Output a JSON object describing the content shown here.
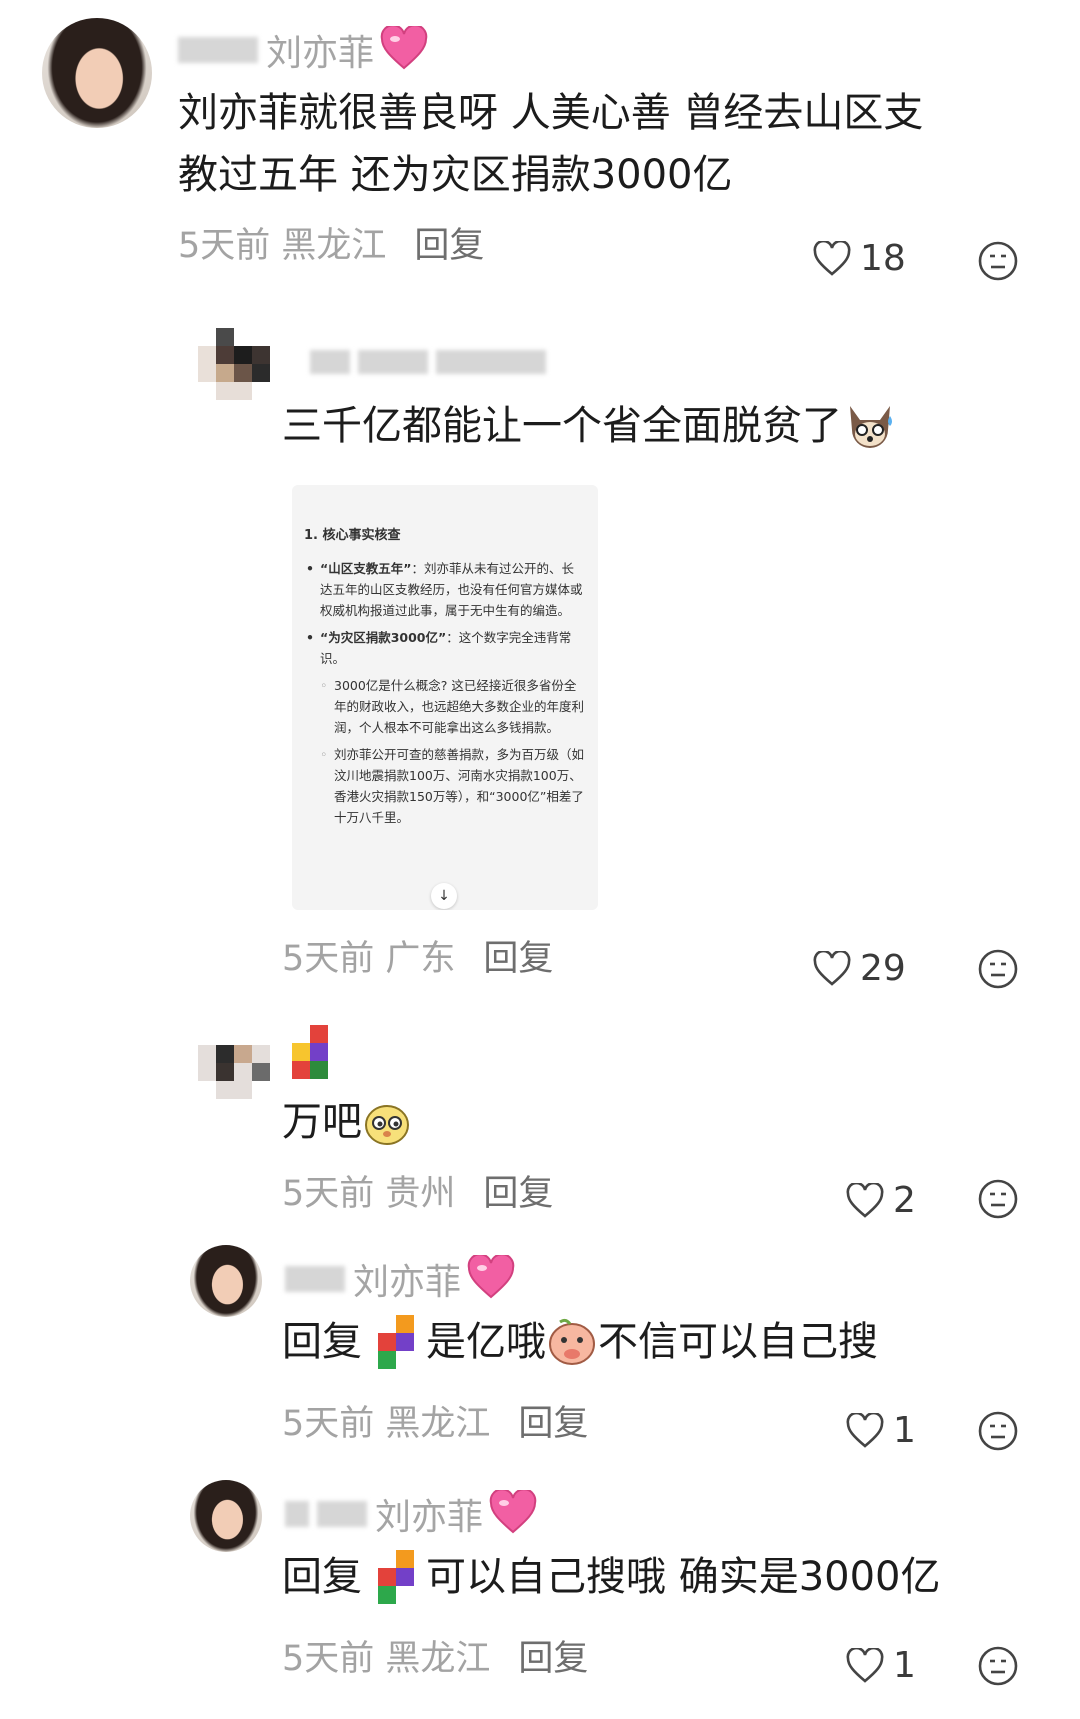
{
  "comments": [
    {
      "name": "刘亦菲",
      "body_line1": "刘亦菲就很善良呀 人美心善 曾经去山区支",
      "body_line2": "教过五年 还为灾区捐款3000亿",
      "time_loc": "5天前 黑龙江",
      "reply": "回复",
      "likes": "18"
    },
    {
      "body": "三千亿都能让一个省全面脱贫了",
      "time_loc": "5天前 广东",
      "reply": "回复",
      "likes": "29"
    },
    {
      "body": "万吧",
      "time_loc": "5天前 贵州",
      "reply": "回复",
      "likes": "2"
    },
    {
      "name": "刘亦菲",
      "reply_prefix": "回复",
      "body_a": "是亿哦",
      "body_b": "不信可以自己搜",
      "time_loc": "5天前 黑龙江",
      "reply": "回复",
      "likes": "1"
    },
    {
      "name": "刘亦菲",
      "reply_prefix": "回复",
      "body": "可以自己搜哦 确实是3000亿",
      "time_loc": "5天前 黑龙江",
      "reply": "回复",
      "likes": "1"
    }
  ],
  "screenshot": {
    "title": "1. 核心事实核查",
    "bullet1_label": "“山区支教五年”",
    "bullet1_text": "：刘亦菲从未有过公开的、长达五年的山区支教经历，也没有任何官方媒体或权威机构报道过此事，属于无中生有的编造。",
    "bullet2_label": "“为灾区捐款3000亿”",
    "bullet2_text": "：这个数字完全违背常识。",
    "sub1": "3000亿是什么概念? 这已经接近很多省份全年的财政收入，也远超绝大多数企业的年度利润，个人根本不可能拿出这么多钱捐款。",
    "sub2": "刘亦菲公开可查的慈善捐款，多为百万级（如汶川地震捐款100万、河南水灾捐款100万、香港火灾捐款150万等），和“3000亿”相差了十万八千里。",
    "arrow": "↓"
  },
  "icons": {
    "like": "heart-outline-icon",
    "dislike": "meh-face-icon",
    "badge": "pink-heart-icon"
  },
  "colors": {
    "meta": "#a3a3a3",
    "text": "#1c1c1c",
    "heart_pink": "#f25fa3"
  }
}
